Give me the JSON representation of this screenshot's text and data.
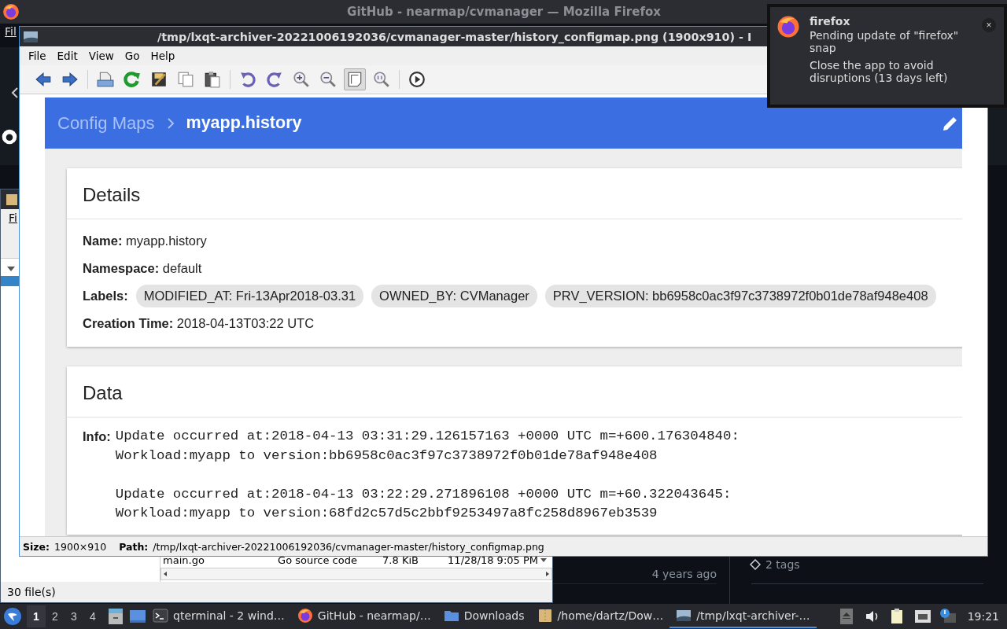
{
  "firefox_window": {
    "title": "GitHub - nearmap/cvmanager — Mozilla Firefox",
    "menu_fragment": "Fil"
  },
  "file_manager": {
    "menu_fragment": "Fi",
    "rows": [
      {
        "name": "main.go",
        "type": "Go source code",
        "size": "7.8 KiB",
        "modified": "11/28/18 9:05 PM"
      }
    ],
    "status": "30 file(s)"
  },
  "github_page": {
    "times": [
      "4 years ago"
    ],
    "tags": "2 tags"
  },
  "image_viewer": {
    "title": "/tmp/lxqt-archiver-20221006192036/cvmanager-master/history_configmap.png (1900x910) - I",
    "menu": [
      "File",
      "Edit",
      "View",
      "Go",
      "Help"
    ],
    "toolbar": [
      {
        "kind": "back",
        "selected": false
      },
      {
        "kind": "forward",
        "selected": false
      },
      {
        "kind": "sep"
      },
      {
        "kind": "open",
        "selected": false
      },
      {
        "kind": "reload",
        "selected": false
      },
      {
        "kind": "save",
        "selected": false
      },
      {
        "kind": "copy",
        "selected": false
      },
      {
        "kind": "paste",
        "selected": false
      },
      {
        "kind": "sep"
      },
      {
        "kind": "rotate_left",
        "selected": false
      },
      {
        "kind": "rotate_right",
        "selected": false
      },
      {
        "kind": "zoom_in",
        "selected": false
      },
      {
        "kind": "zoom_out",
        "selected": false
      },
      {
        "kind": "fit",
        "selected": true
      },
      {
        "kind": "zoom_original",
        "selected": false
      },
      {
        "kind": "sep"
      },
      {
        "kind": "slideshow",
        "selected": false
      }
    ],
    "image": {
      "breadcrumb": [
        "Config Maps",
        "myapp.history"
      ],
      "details": {
        "title": "Details",
        "fields": [
          {
            "kind": "text",
            "label": "Name:",
            "value": "myapp.history"
          },
          {
            "kind": "text",
            "label": "Namespace:",
            "value": "default"
          },
          {
            "kind": "chips",
            "label": "Labels:",
            "chips": [
              "MODIFIED_AT: Fri-13Apr2018-03.31",
              "OWNED_BY: CVManager",
              "PRV_VERSION: bb6958c0ac3f97c3738972f0b01de78af948e408"
            ]
          },
          {
            "kind": "text",
            "label": "Creation Time:",
            "value": "2018-04-13T03:22 UTC"
          }
        ]
      },
      "data": {
        "title": "Data",
        "label": "Info:",
        "entries": [
          [
            "Update occurred at:2018-04-13 03:31:29.126157163 +0000 UTC m=+600.176304840:",
            "Workload:myapp to version:bb6958c0ac3f97c3738972f0b01de78af948e408"
          ],
          [
            "Update occurred at:2018-04-13 03:22:29.271896108 +0000 UTC m=+60.322043645:",
            "Workload:myapp to version:68fd2c57d5c2bbf9253497a8fc258d8967eb3539"
          ]
        ]
      }
    },
    "status": {
      "size_label": "Size:",
      "size": "1900×910",
      "path_label": "Path:",
      "path": "/tmp/lxqt-archiver-20221006192036/cvmanager-master/history_configmap.png"
    }
  },
  "notification": {
    "app": "firefox",
    "message": "Pending update of \"firefox\" snap",
    "detail": "Close the app to avoid disruptions (13 days left)",
    "close": "×"
  },
  "taskbar": {
    "workspaces": [
      {
        "label": "1",
        "selected": true
      },
      {
        "label": "2",
        "selected": false
      },
      {
        "label": "3",
        "selected": false
      },
      {
        "label": "4",
        "selected": false
      }
    ],
    "tasks": [
      {
        "kind": "terminal",
        "label": "qterminal - 2 wind…",
        "selected": false
      },
      {
        "kind": "firefox",
        "label": "GitHub - nearmap/…",
        "selected": false
      },
      {
        "kind": "folder",
        "label": "Downloads",
        "selected": false
      },
      {
        "kind": "archive",
        "label": "/home/dartz/Dow…",
        "selected": false
      },
      {
        "kind": "image",
        "label": "/tmp/lxqt-archiver-…",
        "selected": true
      }
    ],
    "clock": "19:21"
  }
}
